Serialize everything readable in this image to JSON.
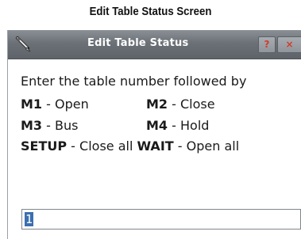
{
  "caption": "Edit Table Status Screen",
  "window": {
    "title": "Edit Table Status",
    "help_button": "?",
    "close_button": "×"
  },
  "instructions": {
    "line1": "Enter the table number followed by",
    "m1_key": "M1",
    "m1_text": " - Open",
    "m2_key": "M2",
    "m2_text": " - Close",
    "m3_key": "M3",
    "m3_text": " - Bus",
    "m4_key": "M4",
    "m4_text": " - Hold",
    "setup_key": "SETUP",
    "setup_text": " - Close all ",
    "wait_key": "WAIT",
    "wait_text": " - Open all"
  },
  "input": {
    "value": "1"
  },
  "colors": {
    "titlebar": "#6b7177",
    "selection": "#3b6fb0",
    "button_glyph": "#d23c2a"
  },
  "icons": {
    "app": "pen-icon",
    "help": "help-icon",
    "close": "close-icon"
  }
}
